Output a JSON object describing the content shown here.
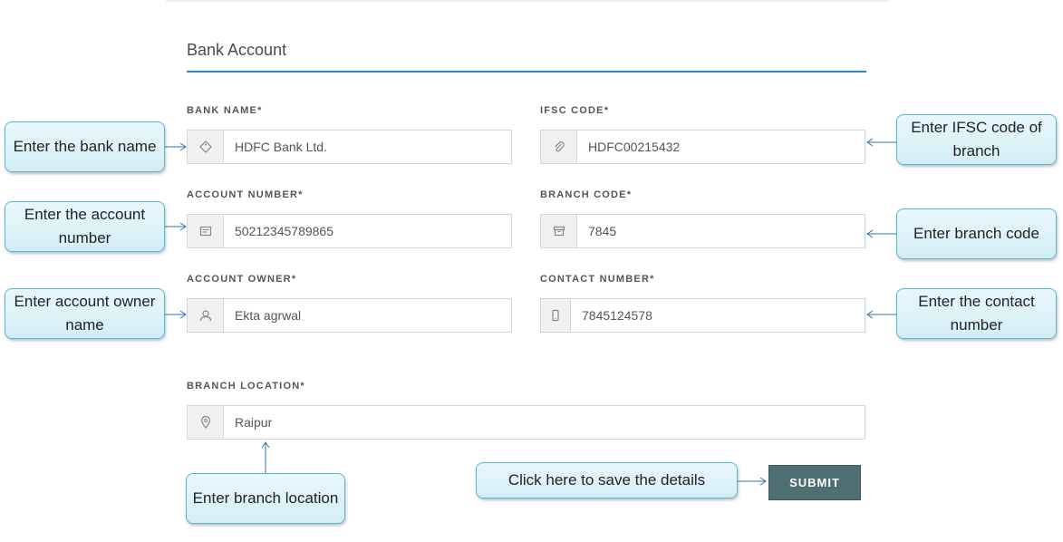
{
  "form": {
    "title": "Bank Account",
    "bank_name": {
      "label": "BANK NAME*",
      "value": "HDFC Bank Ltd."
    },
    "ifsc_code": {
      "label": "IFSC CODE*",
      "value": "HDFC00215432"
    },
    "account_number": {
      "label": "ACCOUNT NUMBER*",
      "value": "50212345789865"
    },
    "branch_code": {
      "label": "BRANCH CODE*",
      "value": "7845"
    },
    "account_owner": {
      "label": "ACCOUNT OWNER*",
      "value": "Ekta agrwal"
    },
    "contact_number": {
      "label": "CONTACT NUMBER*",
      "value": "7845124578"
    },
    "branch_location": {
      "label": "BRANCH LOCATION*",
      "value": "Raipur"
    },
    "submit_label": "SUBMIT"
  },
  "callouts": {
    "bank_name": "Enter the bank name",
    "account_number": "Enter the account number",
    "account_owner": "Enter account owner name",
    "ifsc_code": "Enter IFSC code of branch",
    "branch_code": "Enter branch code",
    "contact_number": "Enter the contact number",
    "branch_location": "Enter branch location",
    "submit": "Click here to save the details"
  },
  "icons": {
    "bank_name": "tag-icon",
    "ifsc_code": "paperclip-icon",
    "account_number": "card-icon",
    "branch_code": "archive-icon",
    "account_owner": "user-icon",
    "contact_number": "phone-icon",
    "branch_location": "map-pin-icon"
  },
  "colors": {
    "accent": "#2e86c1",
    "submit_bg": "#4f6f73",
    "callout_border": "#55b8d6",
    "callout_fill": "#d9f0f7"
  }
}
